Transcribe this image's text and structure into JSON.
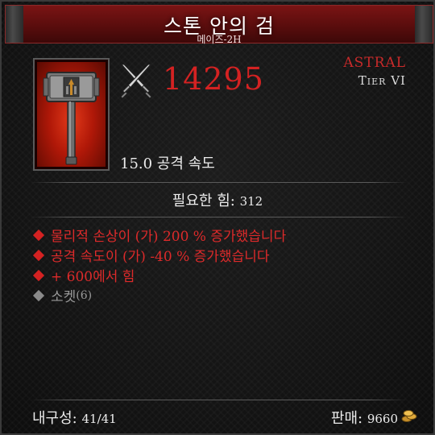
{
  "item": {
    "name": "스톤 안의 검",
    "type": "메이즈-2H",
    "rarity": "ASTRAL",
    "tier": "Tier VI",
    "damage": "14295",
    "attack_speed": "15.0 공격 속도",
    "requirement_label": "필요한 힘:",
    "requirement_value": "312"
  },
  "affixes": [
    {
      "text": "물리적 손상이 (가) 200 % 증가했습니다"
    },
    {
      "text": "공격 속도이 (가) -40 % 증가했습니다"
    },
    {
      "text": "+ 600에서 힘"
    }
  ],
  "socket": {
    "label": "소켓",
    "count": "(6)"
  },
  "footer": {
    "durability_label": "내구성:",
    "durability_value": "41/41",
    "sell_label": "판매:",
    "sell_value": "9660"
  },
  "icons": {
    "weapon": "hammer-icon",
    "damage": "crossed-swords-icon",
    "currency": "gold-coins-icon"
  },
  "colors": {
    "accent_red": "#d42222",
    "header_red": "#7a1414",
    "socket_gray": "#9a9a9a"
  }
}
